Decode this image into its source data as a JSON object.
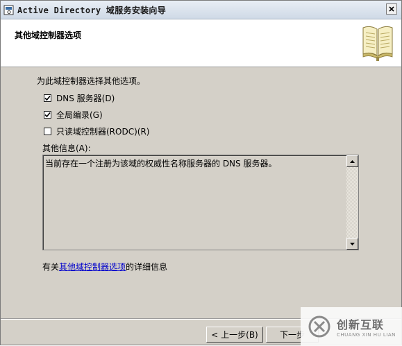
{
  "window": {
    "title": "Active Directory 域服务安装向导",
    "close_glyph": "×"
  },
  "header": {
    "title": "其他域控制器选项",
    "icon": "book-icon"
  },
  "content": {
    "intro": "为此域控制器选择其他选项。",
    "options": [
      {
        "label": "DNS 服务器(D)",
        "checked": true
      },
      {
        "label": "全局编录(G)",
        "checked": true
      },
      {
        "label": "只读域控制器(RODC)(R)",
        "checked": false
      }
    ],
    "info_label": "其他信息(A):",
    "info_text": "当前存在一个注册为该域的权威性名称服务器的 DNS 服务器。",
    "more_info_prefix": "有关",
    "more_info_link": "其他域控制器选项",
    "more_info_suffix": "的详细信息"
  },
  "footer": {
    "back_label": "< 上一步(B)",
    "next_label": "下一步"
  },
  "watermark": {
    "cn": "创新互联",
    "en": "CHUANG XIN HU LIAN"
  },
  "colors": {
    "dialog_bg": "#d4d0c8",
    "link": "#0000cc",
    "title_gradient_top": "#e9eef5",
    "title_gradient_bottom": "#cfd9e6"
  }
}
